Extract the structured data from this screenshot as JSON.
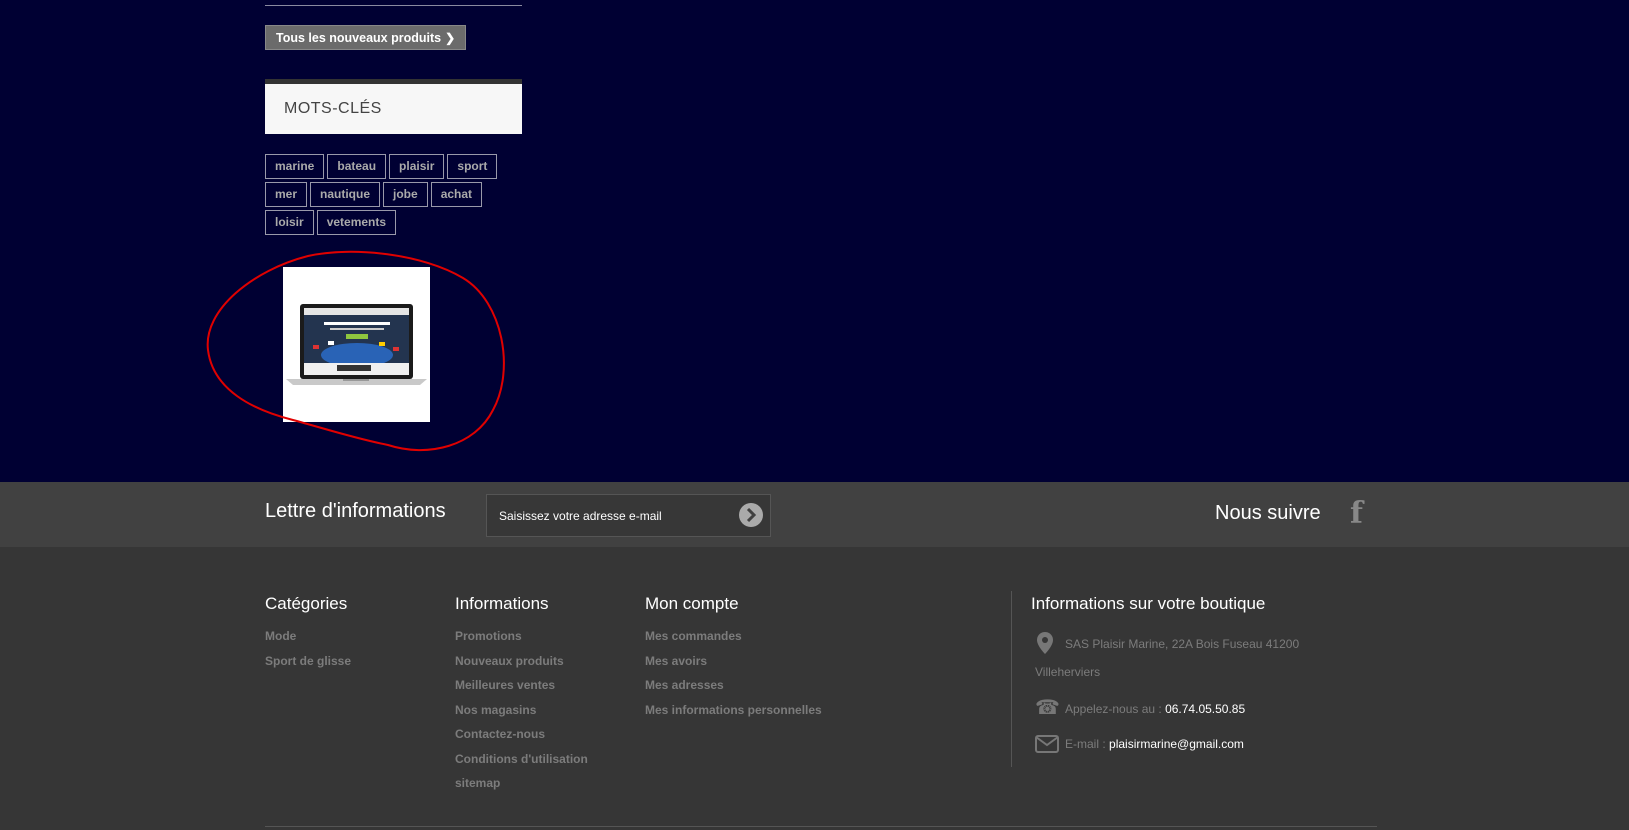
{
  "new_products": {
    "button_label": "Tous les nouveaux produits"
  },
  "tags": {
    "title": "MOTS-CLÉS",
    "rows": [
      [
        "marine",
        "bateau",
        "plaisir",
        "sport"
      ],
      [
        "mer",
        "nautique",
        "jobe",
        "achat"
      ],
      [
        "loisir",
        "vetements"
      ]
    ]
  },
  "newsletter": {
    "title": "Lettre d'informations",
    "placeholder": "Saisissez votre adresse e-mail"
  },
  "follow": {
    "title": "Nous suivre",
    "icon": "facebook-icon"
  },
  "footer": {
    "categories": {
      "title": "Catégories",
      "links": [
        "Mode",
        "Sport de glisse"
      ]
    },
    "informations": {
      "title": "Informations",
      "links": [
        "Promotions",
        "Nouveaux produits",
        "Meilleures ventes",
        "Nos magasins",
        "Contactez-nous",
        "Conditions d'utilisation",
        "sitemap"
      ]
    },
    "account": {
      "title": "Mon compte",
      "links": [
        "Mes commandes",
        "Mes avoirs",
        "Mes adresses",
        "Mes informations personnelles"
      ]
    },
    "store": {
      "title": "Informations sur votre boutique",
      "address_line1": "SAS Plaisir Marine, 22A Bois Fuseau 41200",
      "address_line2": "Villeherviers",
      "phone_label": "Appelez-nous au : ",
      "phone": "06.74.05.50.85",
      "email_label": "E-mail : ",
      "email": "plaisirmarine@gmail.com"
    }
  },
  "colors": {
    "page_bg": "#000033",
    "newsletter_bg": "#414141",
    "footer_bg": "#363636",
    "annotation": "#e00000"
  }
}
